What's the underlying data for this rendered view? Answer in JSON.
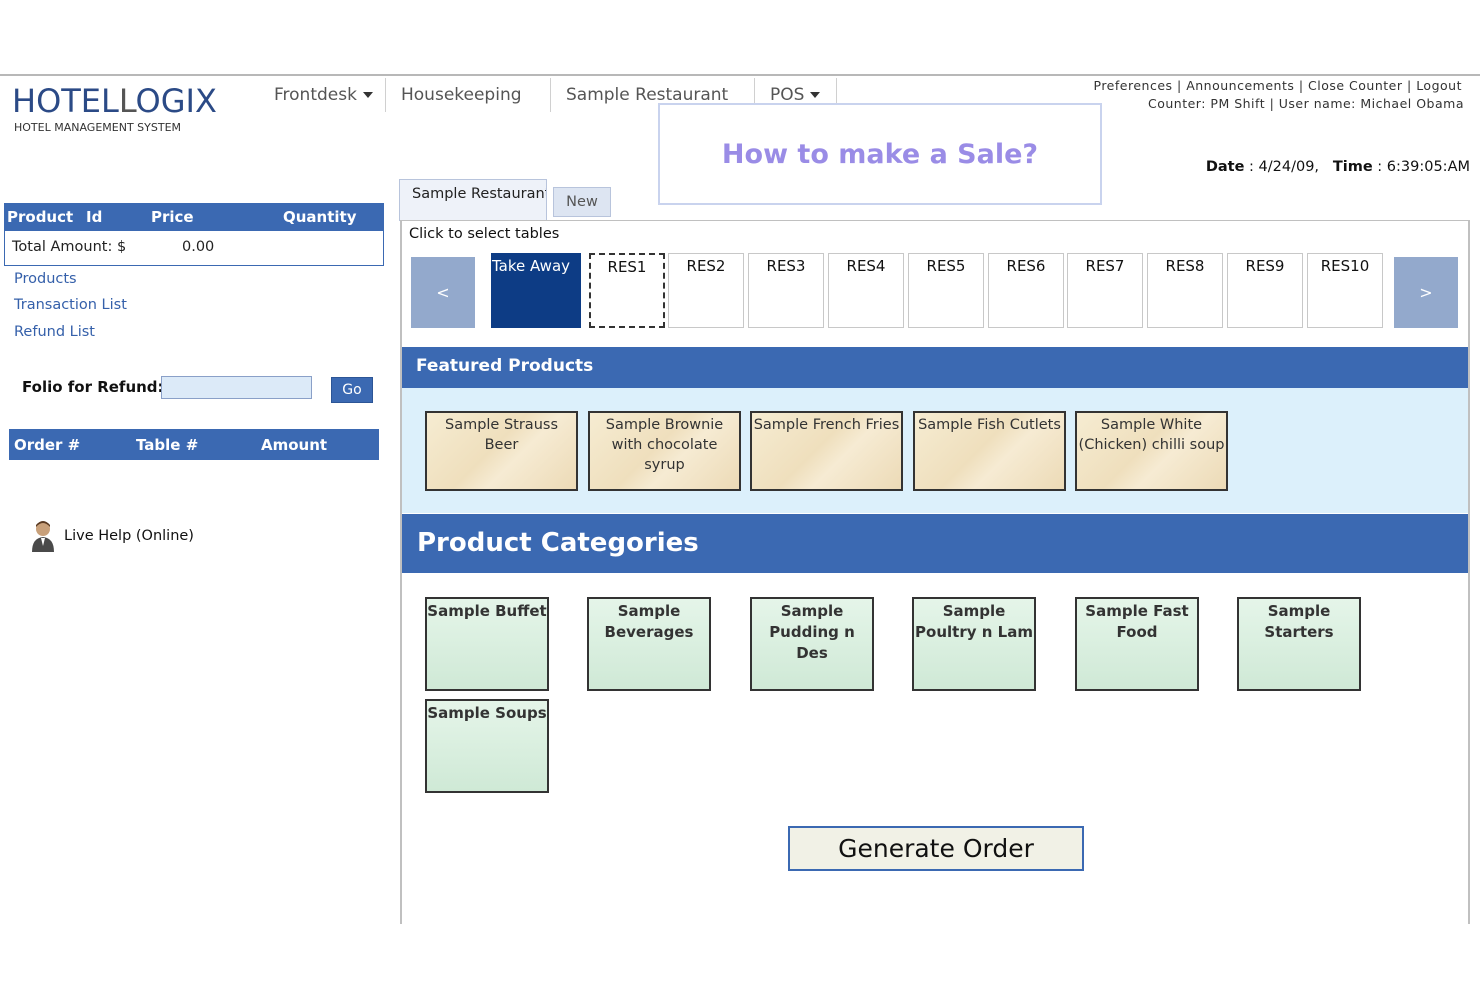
{
  "header": {
    "logo_part1": "HOTEL",
    "logo_part2": "OGIX",
    "logo_letter": "L",
    "logo_subtitle": "HOTEL MANAGEMENT SYSTEM",
    "nav": [
      {
        "label": "Frontdesk",
        "has_dropdown": true
      },
      {
        "label": "Housekeeping",
        "has_dropdown": false
      },
      {
        "label": "Sample Restaurant",
        "has_dropdown": false
      },
      {
        "label": "POS",
        "has_dropdown": true
      }
    ],
    "links": [
      "Preferences",
      "Announcements",
      "Close Counter",
      "Logout"
    ],
    "counter_line": "Counter: PM Shift | User name: Michael Obama",
    "howto": "How to make a Sale?",
    "date_label": "Date",
    "date_value": "4/24/09,",
    "time_label": "Time",
    "time_value": "6:39:05:AM"
  },
  "left_panel": {
    "product_columns": [
      "Product",
      "Id",
      "Price",
      "Quantity"
    ],
    "total_label": "Total Amount: $",
    "total_value": "0.00",
    "links": [
      "Products",
      "Transaction List",
      "Refund List"
    ],
    "folio_label": "Folio for Refund:",
    "folio_value": "",
    "go_label": "Go",
    "order_columns": [
      "Order #",
      "Table #",
      "Amount"
    ],
    "live_help": "Live Help (Online)"
  },
  "tabs": [
    {
      "label": "Sample Restaurant",
      "active": true
    },
    {
      "label": "New",
      "active": false
    }
  ],
  "tables": {
    "instruction": "Click to select tables",
    "prev": "<",
    "next": ">",
    "items": [
      "Take Away",
      "RES1",
      "RES2",
      "RES3",
      "RES4",
      "RES5",
      "RES6",
      "RES7",
      "RES8",
      "RES9",
      "RES10"
    ]
  },
  "featured": {
    "title": "Featured Products",
    "items": [
      "Sample Strauss Beer",
      "Sample Brownie with chocolate syrup",
      "Sample French Fries",
      "Sample Fish Cutlets",
      "Sample White (Chicken) chilli soup"
    ]
  },
  "categories": {
    "title": "Product Categories",
    "items": [
      "Sample Buffet",
      "Sample Beverages",
      "Sample Pudding n Des",
      "Sample Poultry n Lam",
      "Sample Fast Food",
      "Sample Starters",
      "Sample Soups"
    ]
  },
  "generate_label": "Generate Order",
  "colors": {
    "primary_blue": "#3b69b2",
    "selected_table": "#0d3c85",
    "featured_bg": "#dcf0fb",
    "howto_text": "#9a8ce6"
  }
}
